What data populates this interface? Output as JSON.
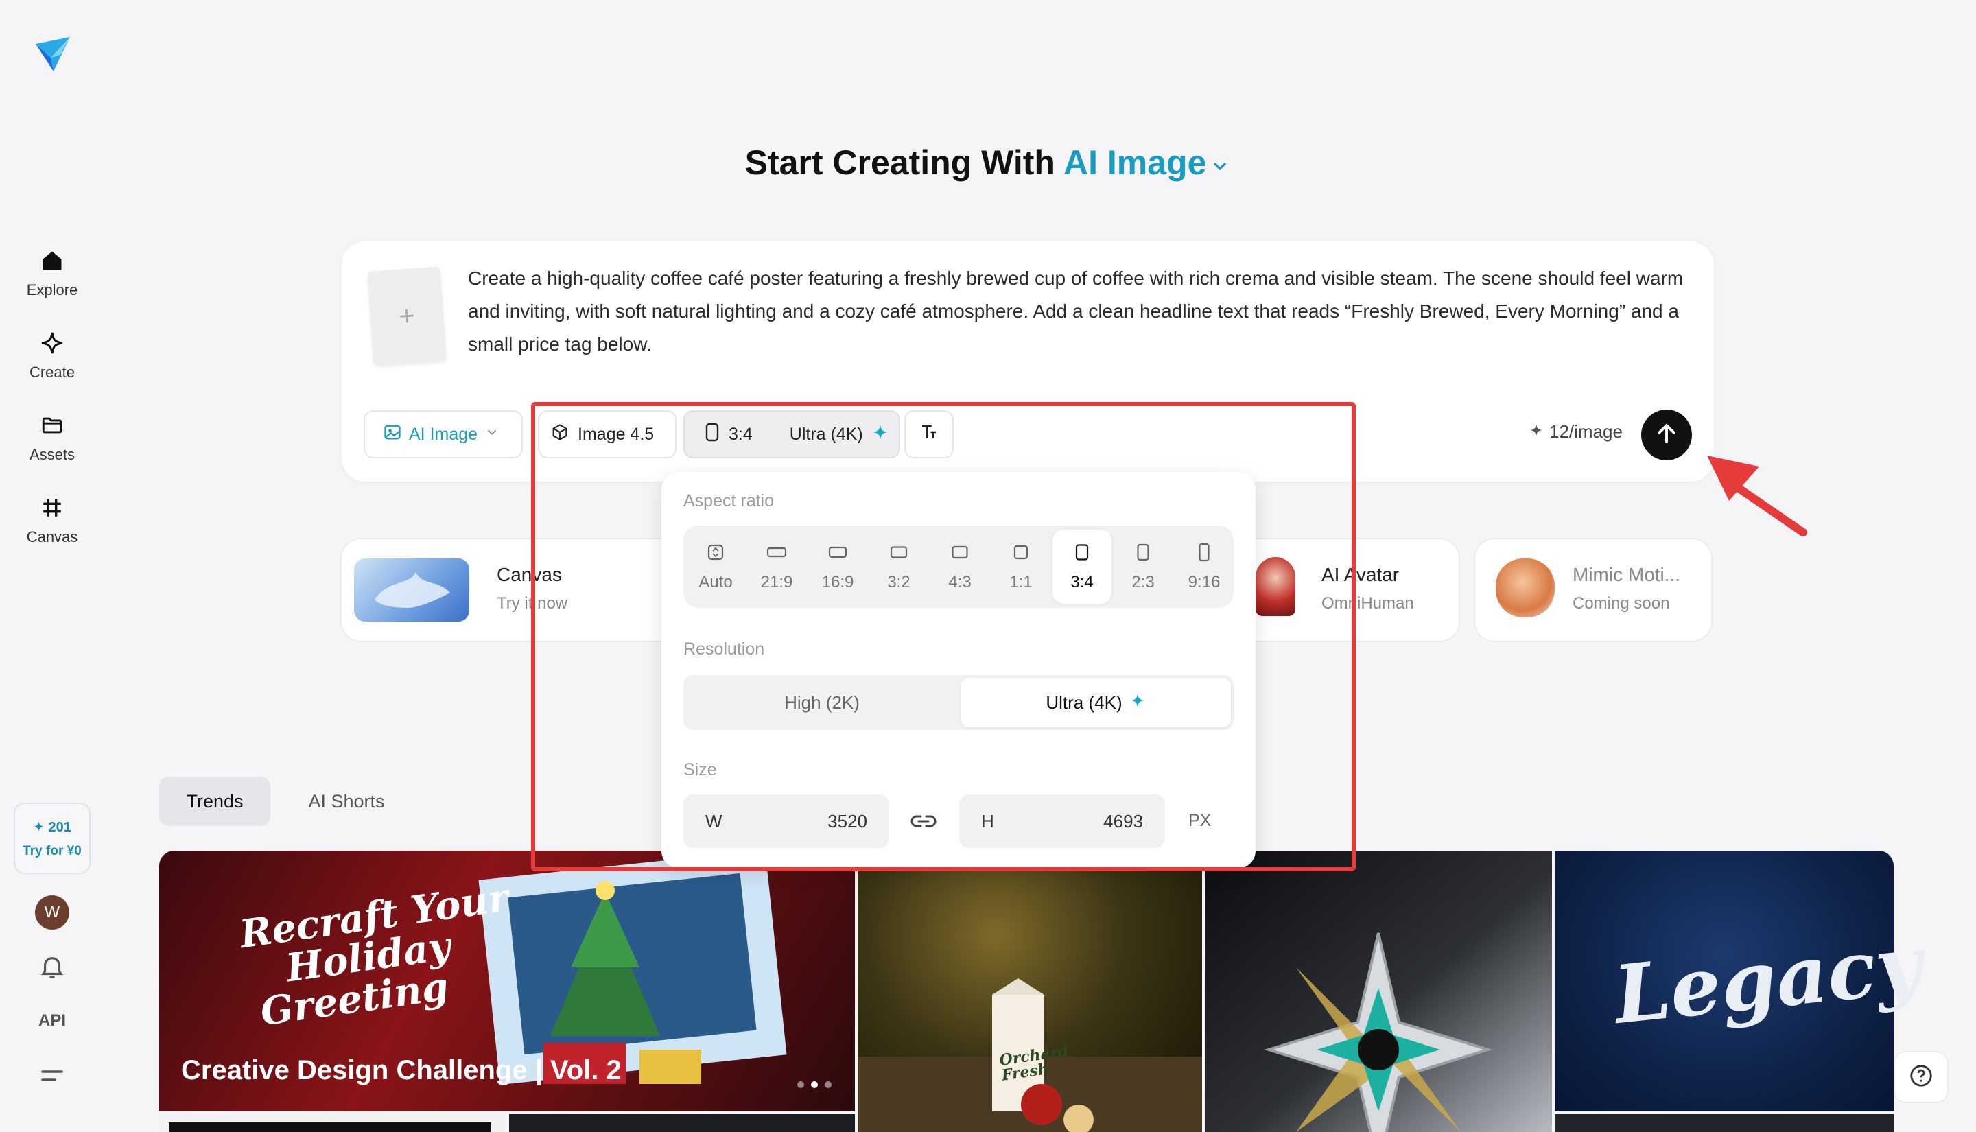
{
  "sidebar": {
    "items": [
      {
        "label": "Explore",
        "icon": "home-icon"
      },
      {
        "label": "Create",
        "icon": "sparkle-icon"
      },
      {
        "label": "Assets",
        "icon": "folder-icon"
      },
      {
        "label": "Canvas",
        "icon": "grid-icon"
      }
    ],
    "credits": "201",
    "try_label": "Try for ¥0",
    "avatar_initial": "W",
    "api_label": "API"
  },
  "heading": {
    "prefix": "Start Creating With",
    "accent": "AI Image"
  },
  "prompt": {
    "text": "Create a high-quality coffee café poster featuring a freshly brewed cup of coffee with rich crema and visible steam. The scene should feel warm and inviting, with soft natural lighting and a cozy café atmosphere. Add a clean headline text that reads “Freshly Brewed, Every Morning” and a small price tag below.",
    "add_symbol": "+"
  },
  "toolbar": {
    "mode": "AI Image",
    "model": "Image 4.5",
    "ratio": "3:4",
    "resolution": "Ultra (4K)",
    "cost": "12/image"
  },
  "features": [
    {
      "title": "Canvas",
      "subtitle": "Try it now"
    },
    {
      "title": "AI Avatar",
      "subtitle": "OmniHuman"
    },
    {
      "title": "Mimic Moti...",
      "subtitle": "Coming soon"
    }
  ],
  "tabs": [
    "Trends",
    "AI Shorts"
  ],
  "gallery": {
    "caption": "Creative Design Challenge | Vol. 2",
    "recraft_lines": [
      "Recraft Your",
      "Holiday",
      "Greeting"
    ],
    "carton_text": "Orchard Fresh",
    "legacy_text": "Legacy"
  },
  "panel": {
    "aspect_label": "Aspect ratio",
    "ratios": [
      "Auto",
      "21:9",
      "16:9",
      "3:2",
      "4:3",
      "1:1",
      "3:4",
      "2:3",
      "9:16"
    ],
    "selected_ratio": "3:4",
    "resolution_label": "Resolution",
    "resolutions": [
      "High (2K)",
      "Ultra (4K)"
    ],
    "selected_resolution": "Ultra (4K)",
    "size_label": "Size",
    "width_label": "W",
    "width": "3520",
    "height_label": "H",
    "height": "4693",
    "unit": "PX"
  },
  "colors": {
    "accent": "#1a9cc0",
    "annotation": "#e53b3b"
  }
}
